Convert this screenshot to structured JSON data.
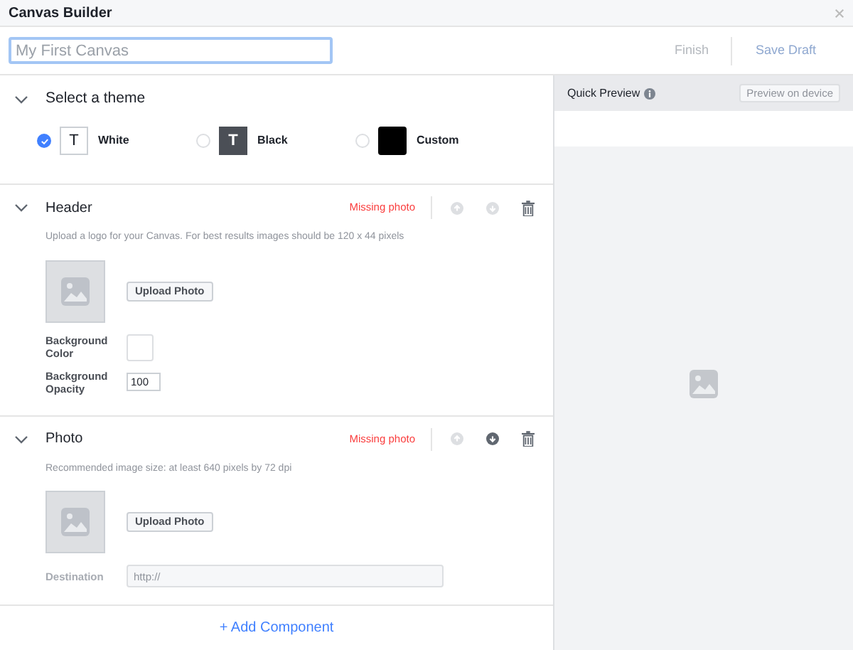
{
  "window": {
    "title": "Canvas Builder"
  },
  "name_field": {
    "placeholder": "My First Canvas"
  },
  "actions": [
    {
      "label": "Finish",
      "disabled": true
    },
    {
      "label": "Save Draft",
      "disabled": false
    }
  ],
  "theme_section": {
    "title": "Select a theme",
    "themes": [
      {
        "label": "White",
        "kind": "white",
        "glyph": "T",
        "selected": true
      },
      {
        "label": "Black",
        "kind": "black",
        "glyph": "T",
        "selected": false
      },
      {
        "label": "Custom",
        "kind": "custom",
        "selected": false
      }
    ]
  },
  "components": [
    {
      "title": "Header",
      "status": "Missing photo",
      "move_up_disabled": true,
      "move_down_disabled": true,
      "hint": "Upload a logo for your Canvas. For best results images should be 120 x 44 pixels",
      "upload_label": "Upload Photo",
      "fields": [
        {
          "kind": "color",
          "label": "Background Color"
        },
        {
          "kind": "number",
          "label": "Background Opacity",
          "value": "100"
        }
      ]
    },
    {
      "title": "Photo",
      "status": "Missing photo",
      "move_up_disabled": true,
      "move_down_disabled": false,
      "hint": "Recommended image size: at least 640 pixels by 72 dpi",
      "upload_label": "Upload Photo",
      "fields": [
        {
          "kind": "url",
          "label": "Destination",
          "placeholder": "http://"
        }
      ]
    }
  ],
  "add_component": "+ Add Component",
  "preview": {
    "title": "Quick Preview",
    "device_button": "Preview on device"
  }
}
